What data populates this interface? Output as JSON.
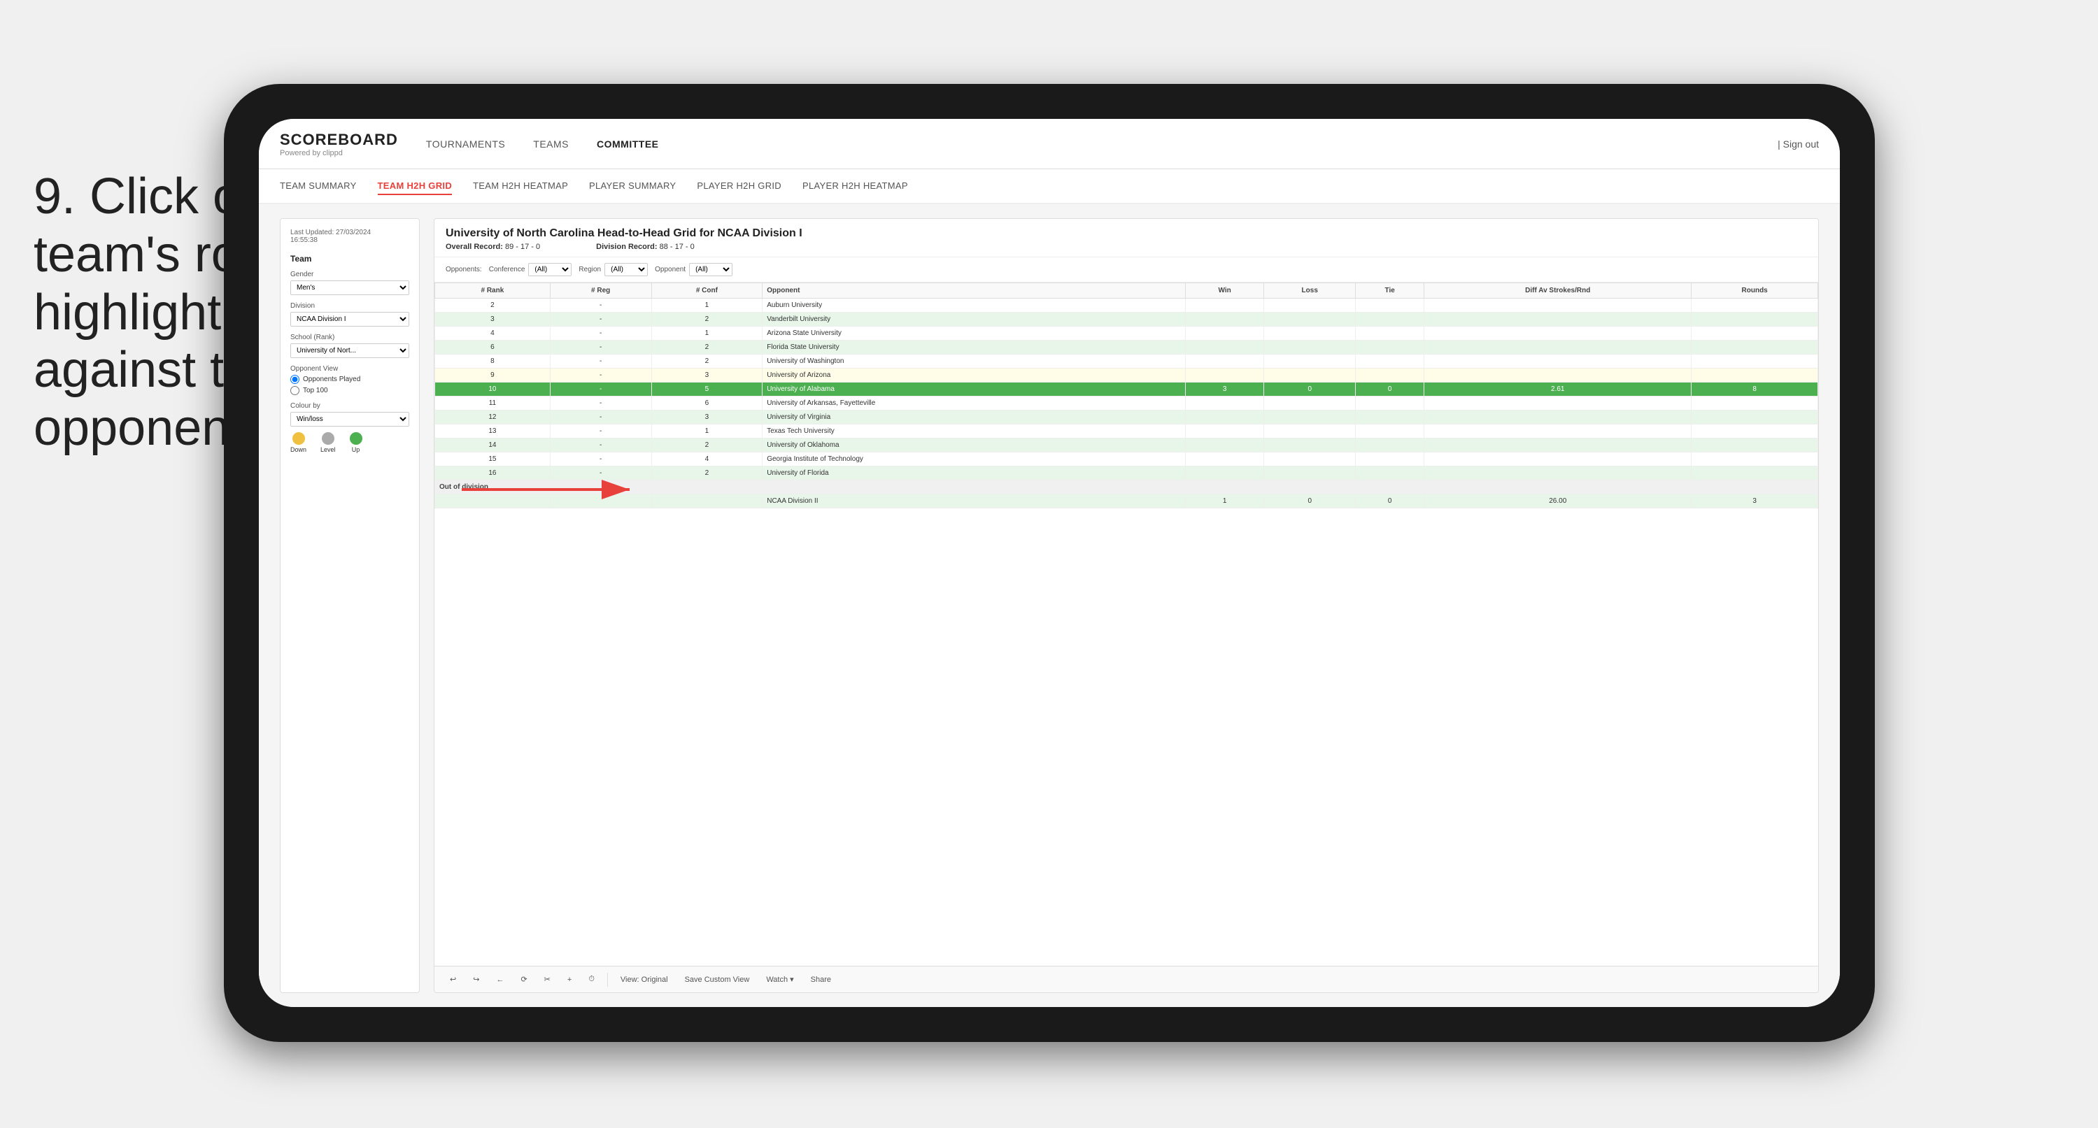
{
  "instruction": {
    "number": "9.",
    "text": "Click on a team's row to highlight results against that opponent"
  },
  "nav": {
    "logo": "SCOREBOARD",
    "logo_sub": "Powered by clippd",
    "links": [
      "TOURNAMENTS",
      "TEAMS",
      "COMMITTEE"
    ],
    "active_link": "COMMITTEE",
    "sign_out": "| Sign out"
  },
  "sub_nav": {
    "links": [
      "TEAM SUMMARY",
      "TEAM H2H GRID",
      "TEAM H2H HEATMAP",
      "PLAYER SUMMARY",
      "PLAYER H2H GRID",
      "PLAYER H2H HEATMAP"
    ],
    "active": "TEAM H2H GRID"
  },
  "sidebar": {
    "last_updated": "Last Updated: 27/03/2024",
    "last_updated_time": "16:55:38",
    "team_label": "Team",
    "gender_label": "Gender",
    "gender_value": "Men's",
    "division_label": "Division",
    "division_value": "NCAA Division I",
    "school_label": "School (Rank)",
    "school_value": "University of Nort...",
    "opponent_view_label": "Opponent View",
    "radio1": "Opponents Played",
    "radio2": "Top 100",
    "colour_by_label": "Colour by",
    "colour_value": "Win/loss",
    "legend_down": "Down",
    "legend_level": "Level",
    "legend_up": "Up"
  },
  "grid": {
    "title": "University of North Carolina Head-to-Head Grid for NCAA Division I",
    "overall_record_label": "Overall Record:",
    "overall_record": "89 - 17 - 0",
    "division_record_label": "Division Record:",
    "division_record": "88 - 17 - 0",
    "filter_opponents_label": "Opponents:",
    "filter_conference_label": "Conference",
    "filter_conference_value": "(All)",
    "filter_region_label": "Region",
    "filter_region_value": "(All)",
    "filter_opponent_label": "Opponent",
    "filter_opponent_value": "(All)",
    "columns": [
      "# Rank",
      "# Reg",
      "# Conf",
      "Opponent",
      "Win",
      "Loss",
      "Tie",
      "Diff Av Strokes/Rnd",
      "Rounds"
    ],
    "rows": [
      {
        "rank": "2",
        "reg": "-",
        "conf": "1",
        "opponent": "Auburn University",
        "win": "",
        "loss": "",
        "tie": "",
        "diff": "",
        "rounds": "",
        "highlight": "none",
        "row_class": ""
      },
      {
        "rank": "3",
        "reg": "-",
        "conf": "2",
        "opponent": "Vanderbilt University",
        "win": "",
        "loss": "",
        "tie": "",
        "diff": "",
        "rounds": "",
        "highlight": "none",
        "row_class": "row-light-green"
      },
      {
        "rank": "4",
        "reg": "-",
        "conf": "1",
        "opponent": "Arizona State University",
        "win": "",
        "loss": "",
        "tie": "",
        "diff": "",
        "rounds": "",
        "highlight": "none",
        "row_class": ""
      },
      {
        "rank": "6",
        "reg": "-",
        "conf": "2",
        "opponent": "Florida State University",
        "win": "",
        "loss": "",
        "tie": "",
        "diff": "",
        "rounds": "",
        "highlight": "none",
        "row_class": "row-light-green"
      },
      {
        "rank": "8",
        "reg": "-",
        "conf": "2",
        "opponent": "University of Washington",
        "win": "",
        "loss": "",
        "tie": "",
        "diff": "",
        "rounds": "",
        "highlight": "none",
        "row_class": ""
      },
      {
        "rank": "9",
        "reg": "-",
        "conf": "3",
        "opponent": "University of Arizona",
        "win": "",
        "loss": "",
        "tie": "",
        "diff": "",
        "rounds": "",
        "highlight": "none",
        "row_class": "row-light-yellow"
      },
      {
        "rank": "10",
        "reg": "-",
        "conf": "5",
        "opponent": "University of Alabama",
        "win": "3",
        "loss": "0",
        "tie": "0",
        "diff": "2.61",
        "rounds": "8",
        "highlight": "highlighted",
        "row_class": "row-highlighted"
      },
      {
        "rank": "11",
        "reg": "-",
        "conf": "6",
        "opponent": "University of Arkansas, Fayetteville",
        "win": "",
        "loss": "",
        "tie": "",
        "diff": "",
        "rounds": "",
        "highlight": "none",
        "row_class": ""
      },
      {
        "rank": "12",
        "reg": "-",
        "conf": "3",
        "opponent": "University of Virginia",
        "win": "",
        "loss": "",
        "tie": "",
        "diff": "",
        "rounds": "",
        "highlight": "none",
        "row_class": "row-light-green"
      },
      {
        "rank": "13",
        "reg": "-",
        "conf": "1",
        "opponent": "Texas Tech University",
        "win": "",
        "loss": "",
        "tie": "",
        "diff": "",
        "rounds": "",
        "highlight": "none",
        "row_class": ""
      },
      {
        "rank": "14",
        "reg": "-",
        "conf": "2",
        "opponent": "University of Oklahoma",
        "win": "",
        "loss": "",
        "tie": "",
        "diff": "",
        "rounds": "",
        "highlight": "none",
        "row_class": "row-light-green"
      },
      {
        "rank": "15",
        "reg": "-",
        "conf": "4",
        "opponent": "Georgia Institute of Technology",
        "win": "",
        "loss": "",
        "tie": "",
        "diff": "",
        "rounds": "",
        "highlight": "none",
        "row_class": ""
      },
      {
        "rank": "16",
        "reg": "-",
        "conf": "2",
        "opponent": "University of Florida",
        "win": "",
        "loss": "",
        "tie": "",
        "diff": "",
        "rounds": "",
        "highlight": "none",
        "row_class": "row-light-green"
      }
    ],
    "out_of_division_label": "Out of division",
    "out_of_division_row": {
      "division": "NCAA Division II",
      "win": "1",
      "loss": "0",
      "tie": "0",
      "diff": "26.00",
      "rounds": "3"
    }
  },
  "toolbar": {
    "undo": "↩",
    "redo": "↪",
    "back": "←",
    "view_original": "View: Original",
    "save_custom": "Save Custom View",
    "watch": "Watch ▾",
    "share": "Share"
  },
  "colors": {
    "active_tab": "#e8413c",
    "highlighted_row": "#4caf50",
    "light_green_row": "#e8f5e9",
    "light_yellow_row": "#fffde7"
  }
}
